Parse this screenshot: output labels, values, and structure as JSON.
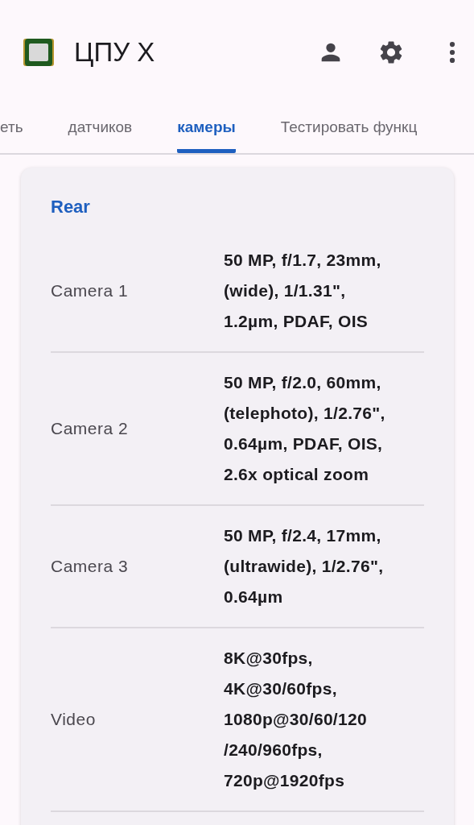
{
  "app_bar": {
    "title": "ЦПУ X"
  },
  "tabs": [
    {
      "label": "еть",
      "selected": false
    },
    {
      "label": "датчиков",
      "selected": false
    },
    {
      "label": "камеры",
      "selected": true
    },
    {
      "label": "Тестировать функц",
      "selected": false
    }
  ],
  "card": {
    "heading": "Rear",
    "rows": [
      {
        "label": "Camera 1",
        "value_lines": [
          "50 MP, f/1.7, 23mm,",
          "(wide), 1/1.31\",",
          "1.2µm, PDAF, OIS"
        ]
      },
      {
        "label": "Camera 2",
        "value_lines": [
          "50 MP, f/2.0, 60mm,",
          "(telephoto), 1/2.76\",",
          "0.64µm, PDAF, OIS,",
          "2.6x optical zoom"
        ]
      },
      {
        "label": "Camera 3",
        "value_lines": [
          "50 MP, f/2.4, 17mm,",
          "(ultrawide), 1/2.76\",",
          "0.64µm"
        ]
      },
      {
        "label": "Video",
        "value_lines": [
          "8K@30fps,",
          "4K@30/60fps,",
          "1080p@30/60/120",
          "/240/960fps,",
          "720p@1920fps"
        ]
      }
    ]
  }
}
